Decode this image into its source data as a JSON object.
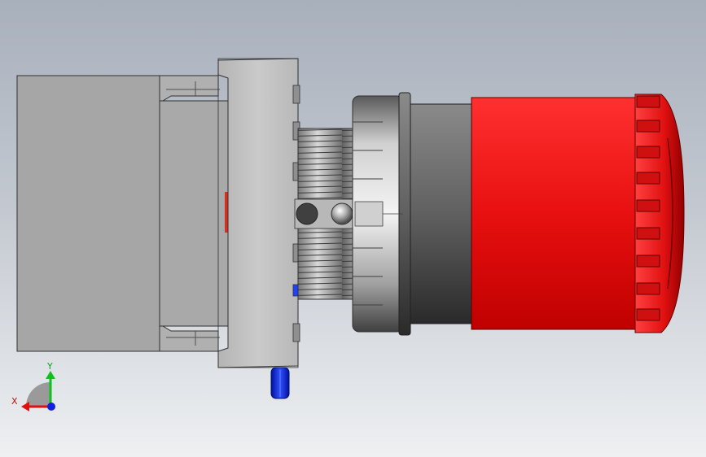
{
  "triad": {
    "x_label": "X",
    "y_label": "Y",
    "x_color": "#e01010",
    "y_color": "#10c020",
    "z_color": "#1020e0"
  },
  "colors": {
    "housing": "#a6a6a6",
    "body": "#c0c0c0",
    "button": "#e81010",
    "connector": "#1030ff",
    "shaft": "#5a5a5a"
  }
}
